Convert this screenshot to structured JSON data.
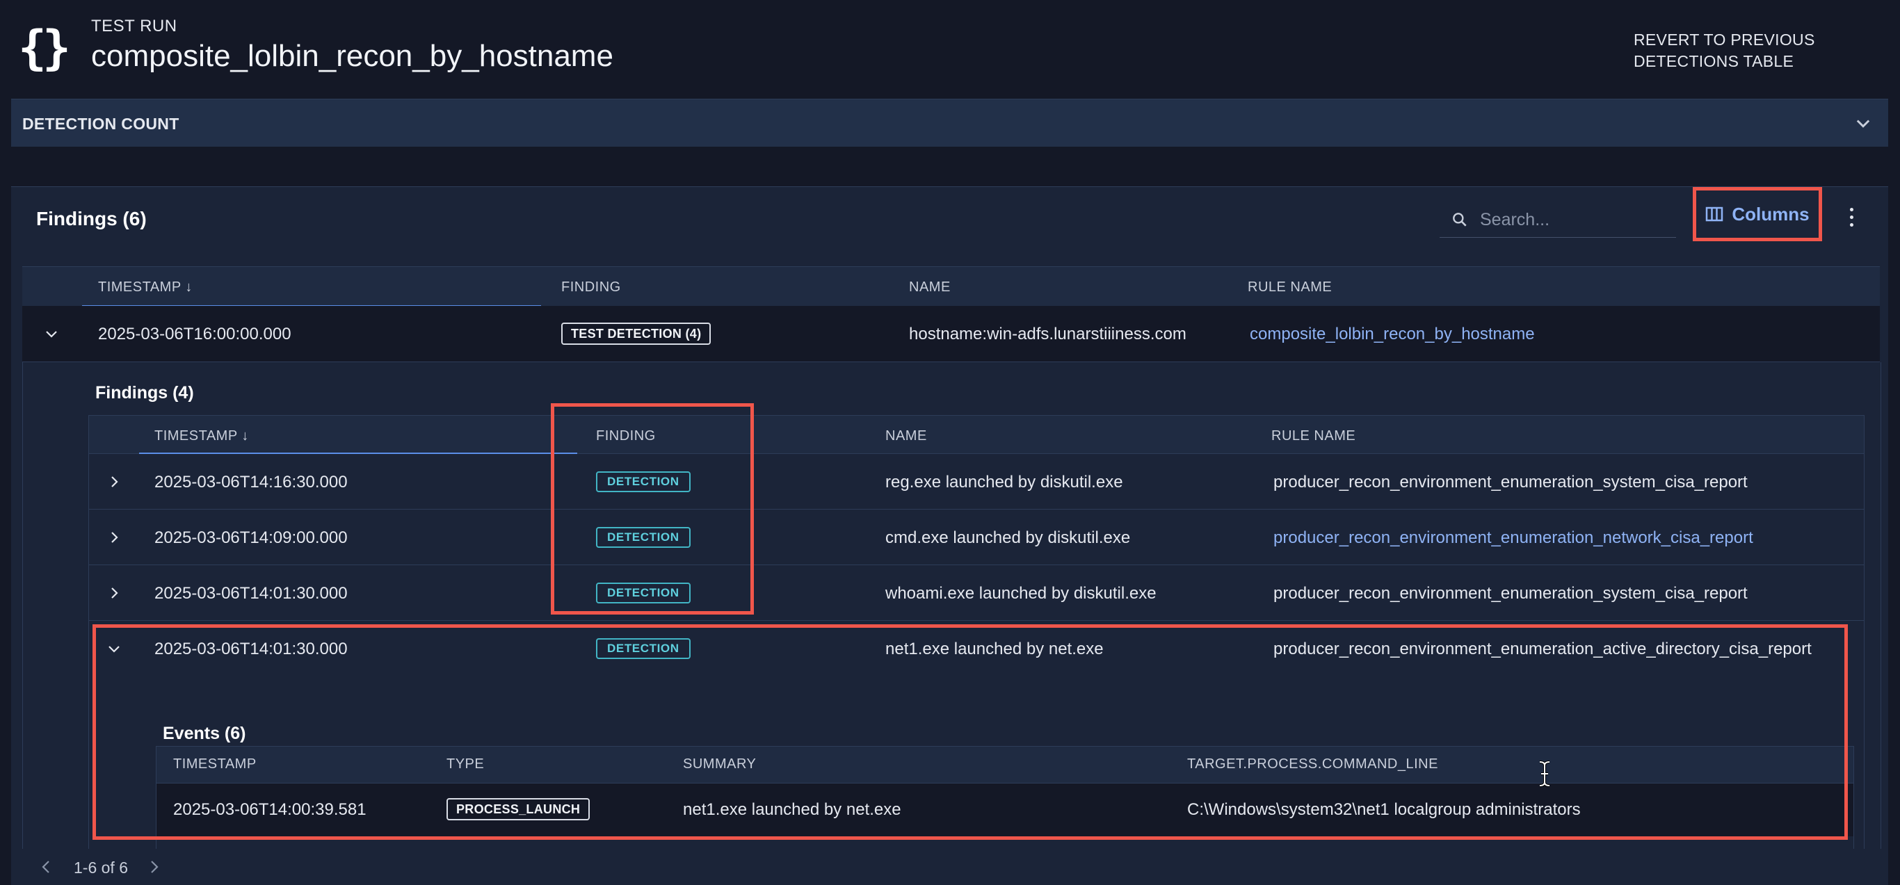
{
  "header": {
    "logo": "{}",
    "label": "TEST RUN",
    "title": "composite_lolbin_recon_by_hostname",
    "revert_label": "REVERT TO PREVIOUS DETECTIONS TABLE"
  },
  "detection_count": {
    "label": "DETECTION COUNT",
    "icon": "chevron-down-icon"
  },
  "findings": {
    "title": "Findings (6)",
    "search": {
      "placeholder": "Search...",
      "value": ""
    },
    "columns_label": "Columns",
    "columns": [
      "TIMESTAMP ↓",
      "FINDING",
      "NAME",
      "RULE NAME"
    ],
    "rows": [
      {
        "timestamp": "2025-03-06T16:00:00.000",
        "finding": "TEST DETECTION (4)",
        "name": "hostname:win-adfs.lunarstiiiness.com",
        "rule": "composite_lolbin_recon_by_hostname",
        "expanded": true
      }
    ],
    "pagination": "1-6 of 6"
  },
  "sub_findings": {
    "title": "Findings (4)",
    "columns": [
      "TIMESTAMP ↓",
      "FINDING",
      "NAME",
      "RULE NAME"
    ],
    "rows": [
      {
        "timestamp": "2025-03-06T14:16:30.000",
        "finding": "DETECTION",
        "name": "reg.exe launched by diskutil.exe",
        "rule": "producer_recon_environment_enumeration_system_cisa_report"
      },
      {
        "timestamp": "2025-03-06T14:09:00.000",
        "finding": "DETECTION",
        "name": "cmd.exe launched by diskutil.exe",
        "rule": "producer_recon_environment_enumeration_network_cisa_report"
      },
      {
        "timestamp": "2025-03-06T14:01:30.000",
        "finding": "DETECTION",
        "name": "whoami.exe launched by diskutil.exe",
        "rule": "producer_recon_environment_enumeration_system_cisa_report"
      },
      {
        "timestamp": "2025-03-06T14:01:30.000",
        "finding": "DETECTION",
        "name": "net1.exe launched by net.exe",
        "rule": "producer_recon_environment_enumeration_active_directory_cisa_report"
      }
    ]
  },
  "events": {
    "title": "Events (6)",
    "columns": [
      "TIMESTAMP",
      "TYPE",
      "SUMMARY",
      "TARGET.PROCESS.COMMAND_LINE"
    ],
    "rows": [
      {
        "timestamp": "2025-03-06T14:00:39.581",
        "type": "PROCESS_LAUNCH",
        "summary": "net1.exe launched by net.exe",
        "command_line": "C:\\Windows\\system32\\net1 localgroup administrators"
      }
    ]
  },
  "colors": {
    "background": "#141826",
    "panel": "#1b2438",
    "accent": "#8fb3f5",
    "highlight": "#f0564b",
    "detection": "#42b5c5"
  }
}
